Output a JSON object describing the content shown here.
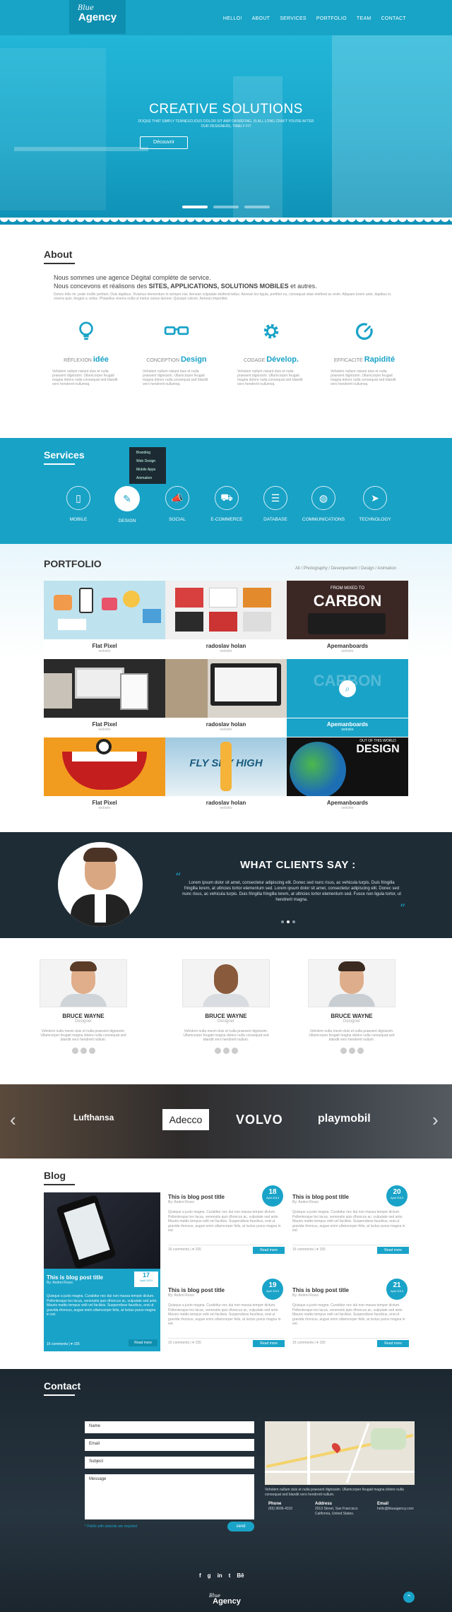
{
  "header": {
    "logo_script": "Blue",
    "logo_name": "Agency",
    "nav": [
      "HELLO!",
      "ABOUT",
      "SERVICES",
      "PORTFOLIO",
      "TEAM",
      "CONTACT"
    ]
  },
  "hero": {
    "title": "CREATIVE SOLUTIONS",
    "subtitle": "DOQUE THAT SIMPLY TENNESCUOUS DOLOR SIT AMP DA'WEFING. IS ALL LONG CRAFT YOU'RE AFTER OUR DESIGNERS, TIMELY FIT",
    "button": "Découvrir"
  },
  "about": {
    "title": "About",
    "lead1": "Nous sommes une agence Dégital complète de service.",
    "lead2_pre": "Nous concevons et réalisons des ",
    "lead2_bold": "SITES, APPLICATIONS, SOLUTIONS MOBILES",
    "lead2_post": " et autres.",
    "small": "Donec felis mi, pede mollis pretium. Duis dapibus. Vivamus elementum in semper nisi. Aenean vulputate eleifend tellus. Aenean leo ligula, porttitor eu, consequat vitae eleifend ac enim. Aliquam lorem ante, dapibus in, viverra quis, feugiat a, tellus. Phasellus viverra nulla ut metus varius laoreet. Quisque rutrum. Aenean imperdiet.",
    "features": [
      {
        "pre": "RÉFLEXION",
        "bold": "idée",
        "text": "Veholem nullum nisiunt duis et nulla praesent dignissim. Ullamcorper feugait magna dolore nulla consequat sed blandit vero hendrerit nullumsq.",
        "icon": "lightbulb-icon"
      },
      {
        "pre": "CONCEPTION",
        "bold": "Design",
        "text": "Veholem nullum nisiunt duis et nulla praesent dignissim. Ullamcorper feugait magna dolore nulla consequat sed blandit vero hendrerit nullumsq.",
        "icon": "glasses-icon"
      },
      {
        "pre": "CODAGE",
        "bold": "Dévelop.",
        "text": "Veholem nullum nisiunt duis et nulla praesent dignissim. Ullamcorper feugait magna dolore nulla consequat sed blandit vero hendrerit nullumsq.",
        "icon": "gear-icon"
      },
      {
        "pre": "EFFICACITÉ",
        "bold": "Rapidité",
        "text": "Veholem nullum nisiunt duis et nulla praesent dignissim. Ullamcorper feugait magna dolore nulla consequat sed blandit vero hendrerit nullumsq.",
        "icon": "speed-gauge-icon"
      }
    ]
  },
  "services": {
    "title": "Services",
    "menu": [
      "Branding",
      "Web Design",
      "Mobile Apps",
      "Animation"
    ],
    "items": [
      {
        "label": "MOBILE",
        "glyph": "▯"
      },
      {
        "label": "DESIGN",
        "glyph": "✎"
      },
      {
        "label": "SOCIAL",
        "glyph": "📣"
      },
      {
        "label": "E-COMMERCE",
        "glyph": "⛟"
      },
      {
        "label": "DATABASE",
        "glyph": "☰"
      },
      {
        "label": "COMMUNICATIONS",
        "glyph": "◍"
      },
      {
        "label": "TECHNOLOGY",
        "glyph": "➤"
      }
    ]
  },
  "portfolio": {
    "title": "PORTFOLIO",
    "filters": "All / Photography / Devenpement / Design / Animation",
    "items": [
      {
        "name": "Flat Pixel",
        "cat": "website"
      },
      {
        "name": "radoslav holan",
        "cat": "website"
      },
      {
        "name": "Apemanboards",
        "cat": "website"
      },
      {
        "name": "Flat Pixel",
        "cat": "website"
      },
      {
        "name": "radoslav holan",
        "cat": "website"
      },
      {
        "name": "Apemanboards",
        "cat": "website"
      },
      {
        "name": "Flat Pixel",
        "cat": "website"
      },
      {
        "name": "radoslav holan",
        "cat": "website"
      },
      {
        "name": "Apemanboards",
        "cat": "website"
      }
    ],
    "thumb_text": {
      "carbon_top": "FROM MIXED TO",
      "carbon": "CARBON",
      "design_top": "OUT OF THIS WORLD",
      "design": "DESIGN",
      "fly": "FLY SKY HIGH",
      "carbon2": "CARBON"
    }
  },
  "testimonials": {
    "title": "WHAT CLIENTS SAY :",
    "text": "Lorem ipsum dolor sit amet, consectetur adipiscing elit. Donec sed nunc risus, ac vehicula turpis. Duis fringilla fringilla lorem, at ultricies tortor elementum sed. Lorem ipsum dolor sit amet, consectetur adipiscing elit. Donec sed nunc risus, ac vehicula turpis. Duis fringilla fringilla lorem, at ultricies tortor elementum sed. Fusce non ligula tortor, ut hendrerit magna."
  },
  "team": [
    {
      "name": "BRUCE WAYNE",
      "role": "Designer",
      "desc": "Veholem nulla mevin duis et nulla praesent dignissim. Ullamcorper feugait magna dolore nulla consequat sed blandit vero hendrerit nullum."
    },
    {
      "name": "BRUCE WAYNE",
      "role": "Designer",
      "desc": "Veholem nulla mevin duis et nulla praesent dignissim. Ullamcorper feugait magna dolore nulla consequat sed blandit vero hendrerit nullum."
    },
    {
      "name": "BRUCE WAYNE",
      "role": "Designer",
      "desc": "Veholem nulla mevin duis et nulla praesent dignissim. Ullamcorper feugait magna dolore nulla consequat sed blandit vero hendrerit nullum."
    }
  ],
  "clients": [
    "Lufthansa",
    "Adecco",
    "VOLVO",
    "playmobil"
  ],
  "blog": {
    "title": "Blog",
    "featured": {
      "title": "This is blog post title",
      "author": "By: Andrei Rossi",
      "day": "17",
      "month": "April 2013",
      "excerpt": "Quisque a justo magna. Curabitur nec dui non massa tempor dictum. Pellentesque leo lacus, venenatis quis dhoncus ac, vulputate sed ante. Mauris mattis tempus velit vel facilisis. Suspendisse faucibus, erat ut gravida rhoncus, augue enim ullamcorper felis, at luctus purus magna in est.",
      "comments": "16 comments",
      "likes": "155",
      "more": "Read more"
    },
    "posts": [
      {
        "title": "This is blog post title",
        "author": "By: Andrei Rossi",
        "day": "18",
        "month": "April 2013",
        "excerpt": "Quisque a justo magna. Curabitur nec dui non massa tempor dictum. Pellentesque leo lacus, venenatis quis dhoncus ac, vulputate sed ante. Mauris mattis tempus velit vel facilisis. Suspendisse faucibus, erat ut gravida rhoncus, augue enim ullamcorper felis, at luctus purus magna in est.",
        "comments": "16 comments",
        "likes": "155",
        "more": "Read more"
      },
      {
        "title": "This is blog post title",
        "author": "By: Andrei Rossi",
        "day": "20",
        "month": "April 2013",
        "excerpt": "Quisque a justo magna. Curabitur nec dui non massa tempor dictum. Pellentesque leo lacus, venenatis quis dhoncus ac, vulputate sed ante. Mauris mattis tempus velit vel facilisis. Suspendisse faucibus, erat ut gravida rhoncus, augue enim ullamcorper felis, at luctus purus magna in est.",
        "comments": "16 comments",
        "likes": "155",
        "more": "Read more"
      },
      {
        "title": "This is blog post title",
        "author": "By: Andrei Rossi",
        "day": "19",
        "month": "April 2013",
        "excerpt": "Quisque a justo magna. Curabitur nec dui non massa tempor dictum. Pellentesque leo lacus, venenatis quis dhoncus ac, vulputate sed ante. Mauris mattis tempus velit vel facilisis. Suspendisse faucibus, erat ut gravida rhoncus, augue enim ullamcorper felis, at luctus purus magna in est.",
        "comments": "16 comments",
        "likes": "155",
        "more": "Read more"
      },
      {
        "title": "This is blog post title",
        "author": "By: Andrei Rossi",
        "day": "21",
        "month": "April 2013",
        "excerpt": "Quisque a justo magna. Curabitur nec dui non massa tempor dictum. Pellentesque leo lacus, venenatis quis dhoncus ac, vulputate sed ante. Mauris mattis tempus velit vel facilisis. Suspendisse faucibus, erat ut gravida rhoncus, augue enim ullamcorper felis, at luctus purus magna in est.",
        "comments": "16 comments",
        "likes": "155",
        "more": "Read more"
      }
    ]
  },
  "contact": {
    "title": "Contact",
    "name": "Name",
    "email": "Email",
    "subject": "Subject",
    "message": "Message",
    "required": "* Fields with asterisk are required",
    "send": "send",
    "info_text": "Veholem nullum duis et nulla praesent dignissim. Ullamcorper feugait magna dolore nulla consequat sed blandit vero hendrerit nullum.",
    "phone_label": "Phone",
    "phone": "(65) 9606-4310",
    "address_label": "Address",
    "address": "2013 Street, San Francisco California, United States.",
    "email_label": "Email",
    "email_value": "hello@bluaagency.com"
  },
  "footer": {
    "logo_script": "Blue",
    "logo_name": "Agency",
    "social": [
      "f",
      "g",
      "in",
      "t",
      "Bē"
    ]
  },
  "colors": {
    "accent": "#1aa3c8",
    "dark": "#1e2c36"
  }
}
